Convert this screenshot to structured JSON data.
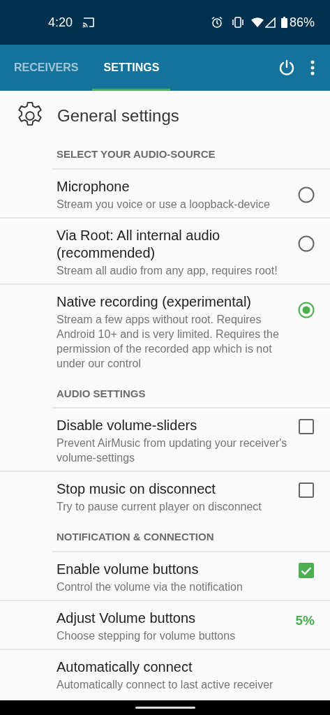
{
  "status_bar": {
    "time": "4:20",
    "battery": "86%"
  },
  "tabs": [
    {
      "label": "RECEIVERS",
      "selected": false
    },
    {
      "label": "SETTINGS",
      "selected": true
    }
  ],
  "page_title": "General settings",
  "sections": [
    {
      "header": "SELECT YOUR AUDIO-SOURCE",
      "items": [
        {
          "kind": "radio",
          "title": "Microphone",
          "summary": "Stream you voice or use a loopback-device",
          "selected": false
        },
        {
          "kind": "radio",
          "title": "Via Root: All internal audio (recommended)",
          "summary": "Stream all audio from any app, requires root!",
          "selected": false
        },
        {
          "kind": "radio",
          "title": "Native recording (experimental)",
          "summary": "Stream a few apps without root. Requires Android 10+ and is very limited. Requires the permission of the recorded app which is not under our control",
          "selected": true
        }
      ]
    },
    {
      "header": "AUDIO SETTINGS",
      "items": [
        {
          "kind": "checkbox",
          "title": "Disable volume-sliders",
          "summary": "Prevent AirMusic from updating your receiver's volume-settings",
          "checked": false
        },
        {
          "kind": "checkbox",
          "title": "Stop music on disconnect",
          "summary": "Try to pause current player on disconnect",
          "checked": false
        }
      ]
    },
    {
      "header": "NOTIFICATION & CONNECTION",
      "items": [
        {
          "kind": "checkbox",
          "title": "Enable volume buttons",
          "summary": "Control the volume via the notification",
          "checked": true
        },
        {
          "kind": "value",
          "title": "Adjust Volume buttons",
          "summary": "Choose stepping for volume buttons",
          "value": "5%"
        },
        {
          "kind": "plain",
          "title": "Automatically connect",
          "summary": "Automatically connect to last active receiver"
        }
      ]
    }
  ]
}
